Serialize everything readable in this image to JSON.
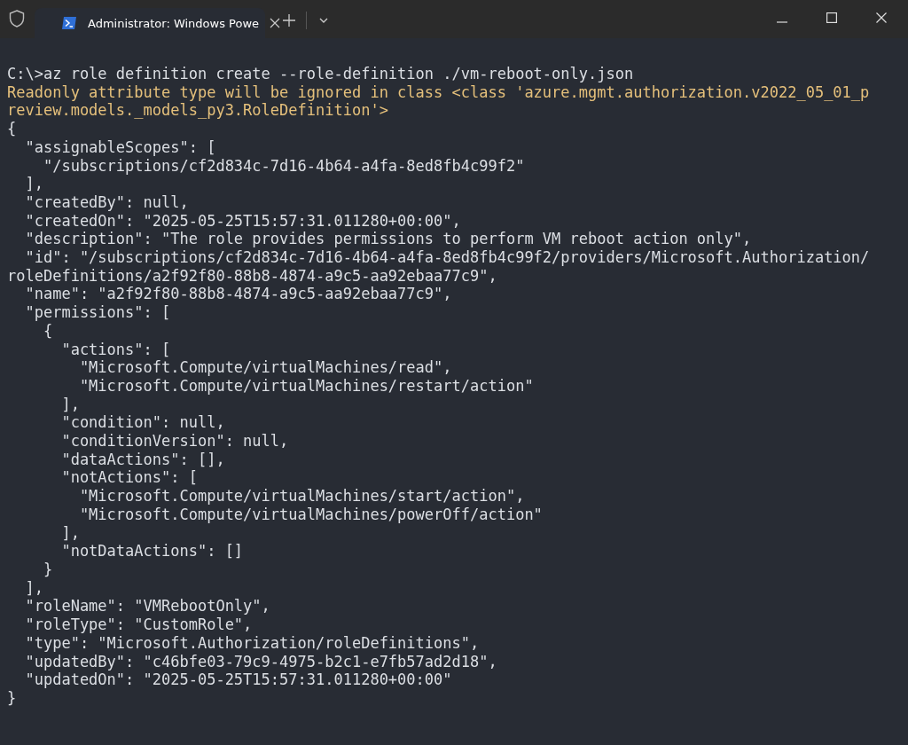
{
  "tab": {
    "title": "Administrator: Windows Powe",
    "selected": true
  },
  "lines": [
    {
      "kind": "command",
      "text": "C:\\>az role definition create --role-definition ./vm-reboot-only.json"
    },
    {
      "kind": "warning",
      "text": "Readonly attribute type will be ignored in class <class 'azure.mgmt.authorization.v2022_05_01_p"
    },
    {
      "kind": "warning",
      "text": "review.models._models_py3.RoleDefinition'>"
    },
    {
      "kind": "output",
      "text": "{"
    },
    {
      "kind": "output",
      "text": "  \"assignableScopes\": ["
    },
    {
      "kind": "output",
      "text": "    \"/subscriptions/cf2d834c-7d16-4b64-a4fa-8ed8fb4c99f2\""
    },
    {
      "kind": "output",
      "text": "  ],"
    },
    {
      "kind": "output",
      "text": "  \"createdBy\": null,"
    },
    {
      "kind": "output",
      "text": "  \"createdOn\": \"2025-05-25T15:57:31.011280+00:00\","
    },
    {
      "kind": "output",
      "text": "  \"description\": \"The role provides permissions to perform VM reboot action only\","
    },
    {
      "kind": "output",
      "text": "  \"id\": \"/subscriptions/cf2d834c-7d16-4b64-a4fa-8ed8fb4c99f2/providers/Microsoft.Authorization/"
    },
    {
      "kind": "output",
      "text": "roleDefinitions/a2f92f80-88b8-4874-a9c5-aa92ebaa77c9\","
    },
    {
      "kind": "output",
      "text": "  \"name\": \"a2f92f80-88b8-4874-a9c5-aa92ebaa77c9\","
    },
    {
      "kind": "output",
      "text": "  \"permissions\": ["
    },
    {
      "kind": "output",
      "text": "    {"
    },
    {
      "kind": "output",
      "text": "      \"actions\": ["
    },
    {
      "kind": "output",
      "text": "        \"Microsoft.Compute/virtualMachines/read\","
    },
    {
      "kind": "output",
      "text": "        \"Microsoft.Compute/virtualMachines/restart/action\""
    },
    {
      "kind": "output",
      "text": "      ],"
    },
    {
      "kind": "output",
      "text": "      \"condition\": null,"
    },
    {
      "kind": "output",
      "text": "      \"conditionVersion\": null,"
    },
    {
      "kind": "output",
      "text": "      \"dataActions\": [],"
    },
    {
      "kind": "output",
      "text": "      \"notActions\": ["
    },
    {
      "kind": "output",
      "text": "        \"Microsoft.Compute/virtualMachines/start/action\","
    },
    {
      "kind": "output",
      "text": "        \"Microsoft.Compute/virtualMachines/powerOff/action\""
    },
    {
      "kind": "output",
      "text": "      ],"
    },
    {
      "kind": "output",
      "text": "      \"notDataActions\": []"
    },
    {
      "kind": "output",
      "text": "    }"
    },
    {
      "kind": "output",
      "text": "  ],"
    },
    {
      "kind": "output",
      "text": "  \"roleName\": \"VMRebootOnly\","
    },
    {
      "kind": "output",
      "text": "  \"roleType\": \"CustomRole\","
    },
    {
      "kind": "output",
      "text": "  \"type\": \"Microsoft.Authorization/roleDefinitions\","
    },
    {
      "kind": "output",
      "text": "  \"updatedBy\": \"c46bfe03-79c9-4975-b2c1-e7fb57ad2d18\","
    },
    {
      "kind": "output",
      "text": "  \"updatedOn\": \"2025-05-25T15:57:31.011280+00:00\""
    },
    {
      "kind": "output",
      "text": "}"
    }
  ]
}
